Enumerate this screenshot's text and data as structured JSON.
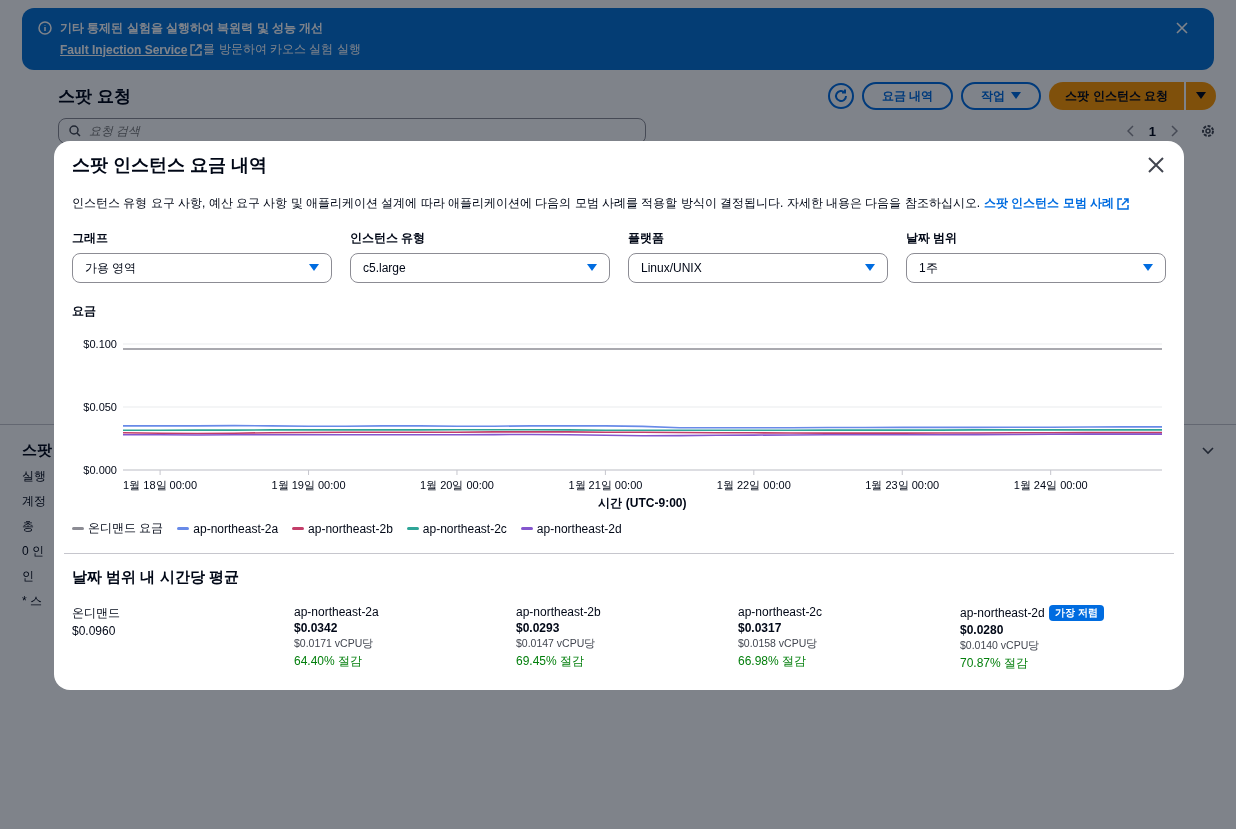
{
  "banner": {
    "title": "기타 통제된 실험을 실행하여 복원력 및 성능 개선",
    "link": "Fault Injection Service",
    "text": "를 방문하여 카오스 실험 실행"
  },
  "page": {
    "title": "스팟 요청",
    "buttons": [
      {
        "kind": "refresh"
      },
      {
        "kind": "normal",
        "label": "요금 내역"
      },
      {
        "kind": "dropdown",
        "label": "작업"
      },
      {
        "kind": "primary",
        "label": "스팟 인스턴스 요청"
      }
    ],
    "search": {
      "placeholder": "요청 검색"
    },
    "page_number": "1"
  },
  "lower_panel": {
    "title": "스팟",
    "lines": [
      "실행",
      "계정",
      "총",
      "0 인",
      "인",
      "* 스"
    ]
  },
  "modal": {
    "title": "스팟 인스턴스 요금 내역",
    "description": "인스턴스 유형 요구 사항, 예산 요구 사항 및 애플리케이션 설계에 따라 애플리케이션에 다음의 모범 사례를 적용할 방식이 결정됩니다. 자세한 내용은 다음을 참조하십시오.",
    "link": "스팟 인스턴스 모범 사례",
    "filters": [
      {
        "label": "그래프",
        "value": "가용 영역"
      },
      {
        "label": "인스턴스 유형",
        "value": "c5.large"
      },
      {
        "label": "플랫폼",
        "value": "Linux/UNIX"
      },
      {
        "label": "날짜 범위",
        "value": "1주"
      }
    ],
    "chart_label": "요금",
    "chart_data": {
      "type": "line",
      "xlabel": "시간 (UTC-9:00)",
      "categories": [
        null,
        "1월 18일 00:00",
        null,
        null,
        null,
        "1월 19일 00:00",
        null,
        null,
        null,
        "1월 20일 00:00",
        null,
        null,
        null,
        "1월 21일 00:00",
        null,
        null,
        null,
        "1월 22일 00:00",
        null,
        null,
        null,
        "1월 23일 00:00",
        null,
        null,
        null,
        "1월 24일 00:00",
        null,
        null,
        null
      ],
      "ylim": [
        0,
        0.1
      ],
      "yticks": [
        {
          "value": 0,
          "label": "$0.000"
        },
        {
          "value": 0.05,
          "label": "$0.050"
        },
        {
          "value": 0.1,
          "label": "$0.100"
        }
      ],
      "series": [
        {
          "name": "온디맨드 요금",
          "color": "#8c8c94",
          "values": [
            0.096,
            0.096,
            0.096,
            0.096,
            0.096,
            0.096,
            0.096,
            0.096,
            0.096,
            0.096,
            0.096,
            0.096,
            0.096,
            0.096,
            0.096,
            0.096,
            0.096,
            0.096,
            0.096,
            0.096,
            0.096,
            0.096,
            0.096,
            0.096,
            0.096,
            0.096,
            0.096,
            0.096,
            0.096
          ]
        },
        {
          "name": "ap-northeast-2a",
          "color": "#688ae8",
          "values": [
            0.035,
            0.035,
            0.035,
            0.0352,
            0.035,
            0.0348,
            0.0348,
            0.035,
            0.035,
            0.0348,
            0.0348,
            0.035,
            0.035,
            0.035,
            0.0346,
            0.0336,
            0.0335,
            0.0335,
            0.0336,
            0.0337,
            0.0337,
            0.0338,
            0.0338,
            0.0338,
            0.034,
            0.034,
            0.0341,
            0.0342,
            0.0342
          ]
        },
        {
          "name": "ap-northeast-2b",
          "color": "#c33d69",
          "values": [
            0.0295,
            0.0292,
            0.029,
            0.0292,
            0.0296,
            0.0298,
            0.03,
            0.03,
            0.03,
            0.03,
            0.0302,
            0.0302,
            0.0302,
            0.03,
            0.03,
            0.0298,
            0.0296,
            0.0295,
            0.0294,
            0.0293,
            0.0293,
            0.0293,
            0.0294,
            0.0294,
            0.0295,
            0.0296,
            0.0297,
            0.0297,
            0.0297
          ]
        },
        {
          "name": "ap-northeast-2c",
          "color": "#2ea597",
          "values": [
            0.0315,
            0.0316,
            0.0317,
            0.0317,
            0.0318,
            0.0318,
            0.0318,
            0.0318,
            0.0318,
            0.0319,
            0.032,
            0.032,
            0.0318,
            0.0316,
            0.0315,
            0.0315,
            0.0315,
            0.0316,
            0.0316,
            0.0317,
            0.0317,
            0.0317,
            0.0317,
            0.0318,
            0.0318,
            0.0318,
            0.0318,
            0.0318,
            0.0318
          ]
        },
        {
          "name": "ap-northeast-2d",
          "color": "#8456ce",
          "values": [
            0.028,
            0.0279,
            0.0278,
            0.0279,
            0.028,
            0.028,
            0.028,
            0.028,
            0.028,
            0.028,
            0.0281,
            0.0282,
            0.028,
            0.0275,
            0.0272,
            0.0273,
            0.0275,
            0.0277,
            0.0278,
            0.0279,
            0.028,
            0.028,
            0.028,
            0.0281,
            0.0282,
            0.0283,
            0.0285,
            0.0285,
            0.0285
          ]
        }
      ]
    },
    "summary_title": "날짜 범위 내 시간당 평균",
    "summary": [
      {
        "kind": "on_demand",
        "name": "온디맨드",
        "price": "$0.0960"
      },
      {
        "kind": "zone",
        "name": "ap-northeast-2a",
        "price": "$0.0342",
        "per_vcpu": "$0.0171 vCPU당",
        "savings": "64.40% 절감"
      },
      {
        "kind": "zone",
        "name": "ap-northeast-2b",
        "price": "$0.0293",
        "per_vcpu": "$0.0147 vCPU당",
        "savings": "69.45% 절감"
      },
      {
        "kind": "zone",
        "name": "ap-northeast-2c",
        "price": "$0.0317",
        "per_vcpu": "$0.0158 vCPU당",
        "savings": "66.98% 절감"
      },
      {
        "kind": "zone",
        "name": "ap-northeast-2d",
        "badge": "가장 저렴",
        "price": "$0.0280",
        "per_vcpu": "$0.0140 vCPU당",
        "savings": "70.87% 절감"
      }
    ]
  }
}
